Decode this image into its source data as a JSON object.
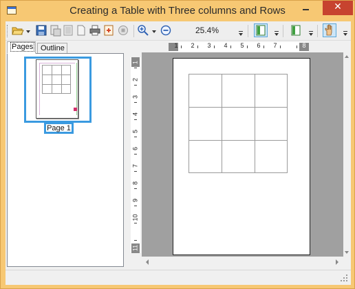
{
  "window": {
    "title": "Creating a Table with Three columns and Rows",
    "close_label": "✕"
  },
  "toolbar": {
    "zoom_value": "25.4%"
  },
  "left_pane": {
    "tabs": [
      {
        "label": "Pages"
      },
      {
        "label": "Outline"
      }
    ],
    "thumbnail_label": "Page 1"
  },
  "rulers": {
    "horizontal": [
      "1",
      "2",
      "3",
      "4",
      "5",
      "6",
      "7",
      "8"
    ],
    "vertical": [
      "1",
      "2",
      "3",
      "4",
      "5",
      "6",
      "7",
      "8",
      "9",
      "10",
      "11"
    ]
  },
  "document": {
    "table": {
      "columns": 3,
      "rows": 3
    }
  },
  "colors": {
    "title_bar": "#f7c873",
    "close_button": "#c7432f",
    "selection": "#3a9ae0",
    "preview_bg": "#a0a0a0"
  }
}
